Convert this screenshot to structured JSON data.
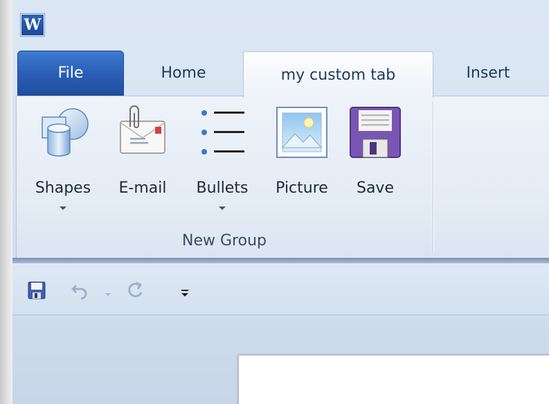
{
  "app": {
    "icon_letter": "W"
  },
  "tabs": [
    {
      "label": "File"
    },
    {
      "label": "Home"
    },
    {
      "label": "my custom tab"
    },
    {
      "label": "Insert"
    }
  ],
  "ribbon": {
    "group_label": "New Group",
    "buttons": [
      {
        "label": "Shapes",
        "icon": "shapes-icon",
        "has_dropdown": true
      },
      {
        "label": "E-mail",
        "icon": "email-icon",
        "has_dropdown": false
      },
      {
        "label": "Bullets",
        "icon": "bullets-icon",
        "has_dropdown": true
      },
      {
        "label": "Picture",
        "icon": "picture-icon",
        "has_dropdown": false
      },
      {
        "label": "Save",
        "icon": "save-icon",
        "has_dropdown": false
      }
    ]
  },
  "quick_access": {
    "items": [
      {
        "icon": "save-icon"
      },
      {
        "icon": "undo-icon"
      },
      {
        "icon": "undo-dropdown-icon"
      },
      {
        "icon": "redo-icon"
      },
      {
        "icon": "customize-toolbar-icon"
      }
    ]
  },
  "colors": {
    "file_tab": "#2a5db5",
    "ribbon_bg": "#e3ebf5",
    "text": "#1e395b"
  }
}
